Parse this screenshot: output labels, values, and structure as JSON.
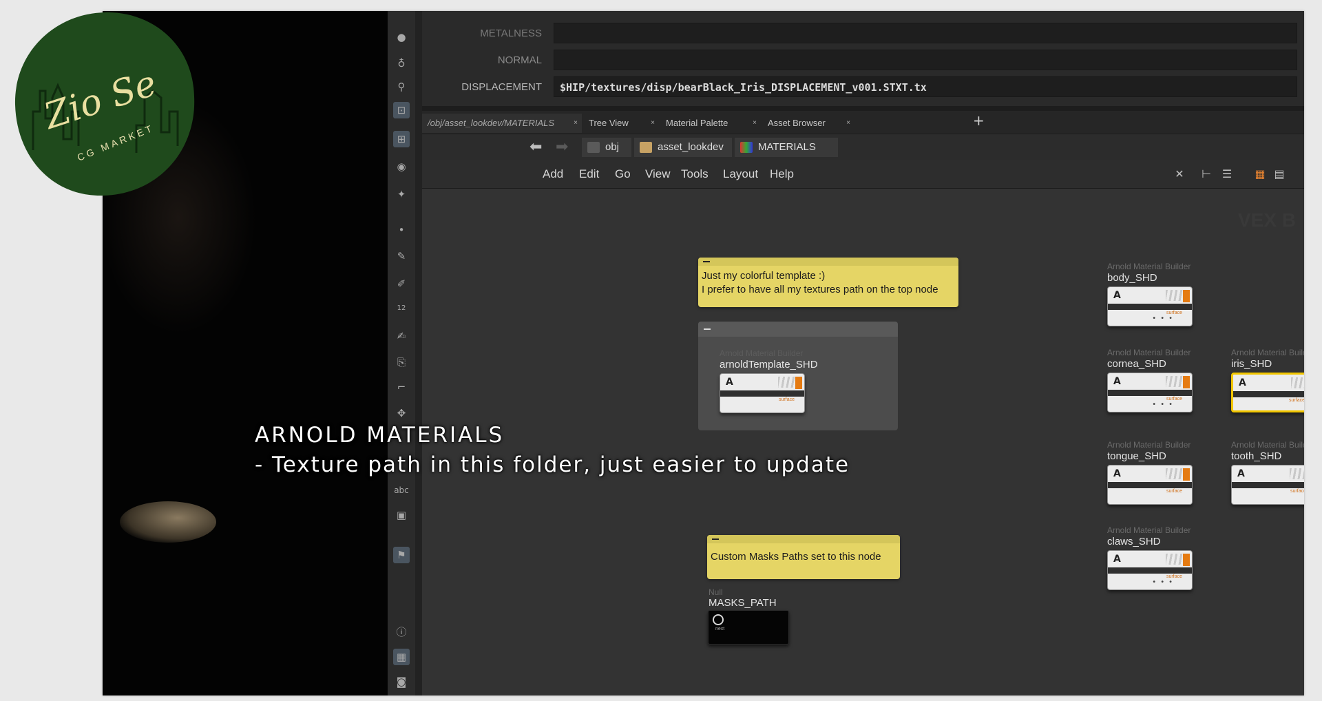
{
  "logo": {
    "script_text": "Zio Se",
    "sub_text": "CG MARKET",
    "color": "#1f4a1c"
  },
  "overlay": {
    "title": "ARNOLD MATERIALS",
    "subtitle": "- Texture path in this folder, just easier to update"
  },
  "params": {
    "metalness_label": "METALNESS",
    "normal_label": "NORMAL",
    "displacement_label": "DISPLACEMENT",
    "displacement_value": "$HIP/textures/disp/bearBlack_Iris_DISPLACEMENT_v001.STXT.tx"
  },
  "tabs": [
    {
      "label": "/obj/asset_lookdev/MATERIALS"
    },
    {
      "label": "Tree View"
    },
    {
      "label": "Material Palette"
    },
    {
      "label": "Asset Browser"
    }
  ],
  "path": {
    "root": "obj",
    "parent": "asset_lookdev",
    "current": "MATERIALS"
  },
  "menu": [
    "Add",
    "Edit",
    "Go",
    "View",
    "Tools",
    "Layout",
    "Help"
  ],
  "toolbar": {
    "abc_label": "abc",
    "number_label": "12"
  },
  "network": {
    "watermark": "VEX B",
    "sticky_top": {
      "line1": "Just my colorful template :)",
      "line2": "I prefer to have all my textures path on the top node"
    },
    "sticky_masks": {
      "text": "Custom Masks Paths set to this node"
    },
    "node_type": "Arnold Material Builder",
    "output_label": "surface",
    "nodes": [
      {
        "name": "arnoldTemplate_SHD",
        "selected": false
      },
      {
        "name": "body_SHD",
        "selected": false
      },
      {
        "name": "cornea_SHD",
        "selected": false
      },
      {
        "name": "iris_SHD",
        "selected": true
      },
      {
        "name": "tongue_SHD",
        "selected": false
      },
      {
        "name": "tooth_SHD",
        "selected": false
      },
      {
        "name": "claws_SHD",
        "selected": false
      }
    ],
    "null_node": {
      "type": "Null",
      "name": "MASKS_PATH",
      "output_label": "next"
    }
  },
  "colors": {
    "selection": "#f2c600",
    "sticky": "#e5d565",
    "surface_output": "#e57b12"
  }
}
